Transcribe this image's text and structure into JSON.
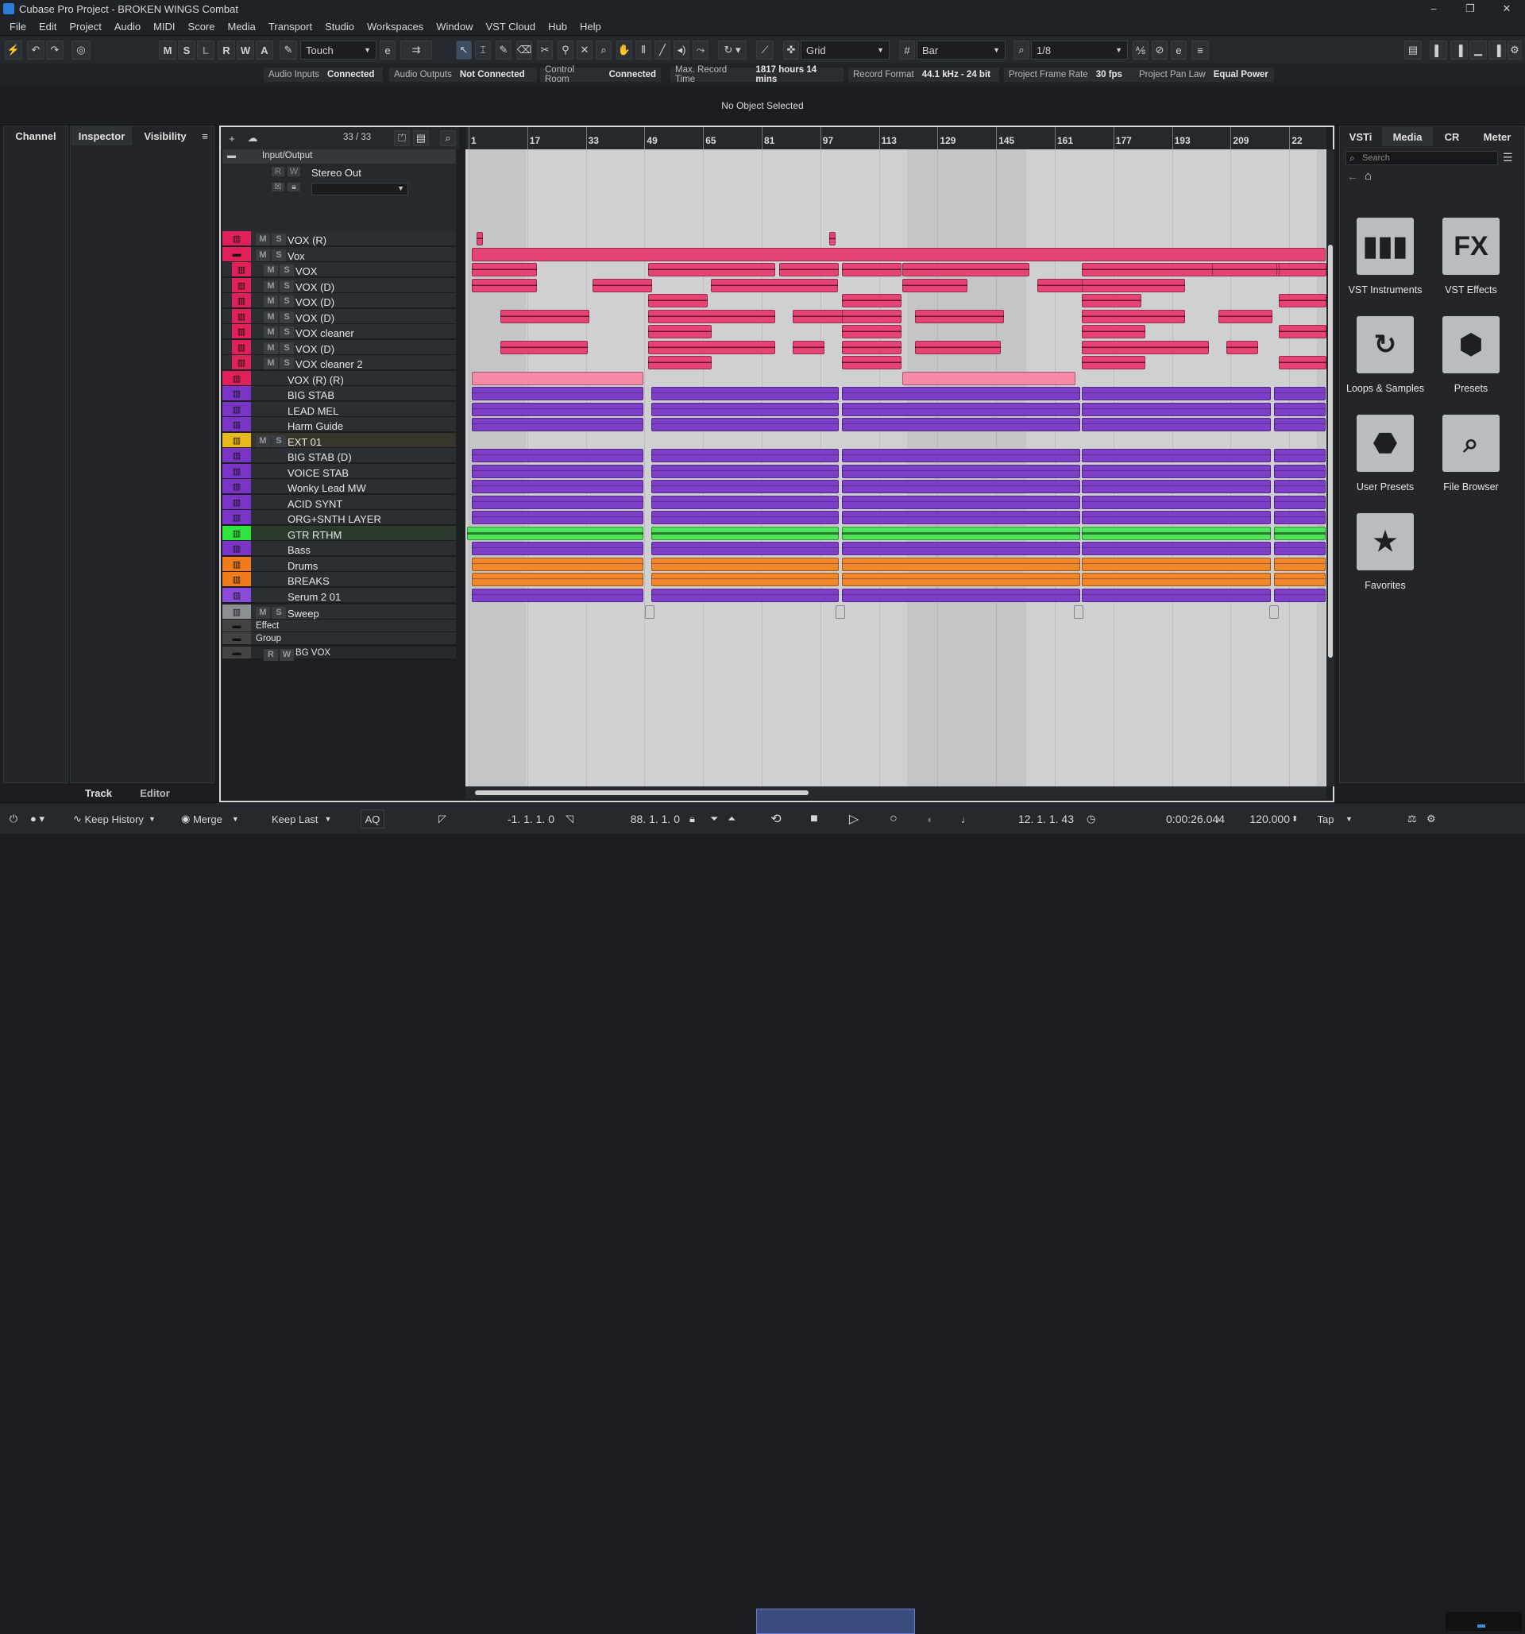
{
  "window": {
    "title": "Cubase Pro Project - BROKEN WINGS Combat"
  },
  "menu": [
    "File",
    "Edit",
    "Project",
    "Audio",
    "MIDI",
    "Score",
    "Media",
    "Transport",
    "Studio",
    "Workspaces",
    "Window",
    "VST Cloud",
    "Hub",
    "Help"
  ],
  "toolbar": {
    "m": "M",
    "s": "S",
    "l": "L",
    "r": "R",
    "w": "W",
    "a": "A",
    "automation_mode": "Touch",
    "snap_type": "Grid",
    "grid_type": "Bar",
    "quantize": "1/8"
  },
  "status": [
    {
      "label": "Audio Inputs",
      "value": "Connected"
    },
    {
      "label": "Audio Outputs",
      "value": "Not Connected"
    },
    {
      "label": "Control Room",
      "value": "Connected"
    },
    {
      "label": "Max. Record Time",
      "value": "1817 hours 14 mins"
    },
    {
      "label": "Record Format",
      "value": "44.1 kHz - 24 bit"
    },
    {
      "label": "Project Frame Rate",
      "value": "30 fps"
    },
    {
      "label": "Project Pan Law",
      "value": "Equal Power"
    }
  ],
  "info_line": "No Object Selected",
  "left_zone": {
    "tab_channel": "Channel",
    "tab_inspector": "Inspector",
    "tab_visibility": "Visibility",
    "tab_track": "Track",
    "tab_editor": "Editor"
  },
  "track_list": {
    "count": "33 / 33",
    "io_folder": "Input/Output",
    "stereo_out": "Stereo Out",
    "r": "R",
    "w": "W",
    "tracks": [
      {
        "name": "VOX (R)",
        "color": "#e0205a",
        "ms": true
      },
      {
        "name": "Vox",
        "color": "#e0205a",
        "ms": true
      },
      {
        "name": "VOX",
        "color": "#e0205a",
        "ms": true
      },
      {
        "name": "VOX (D)",
        "color": "#e0205a",
        "ms": true
      },
      {
        "name": "VOX (D)",
        "color": "#e0205a",
        "ms": true
      },
      {
        "name": "VOX (D)",
        "color": "#e0205a",
        "ms": true
      },
      {
        "name": "VOX cleaner",
        "color": "#e0205a",
        "ms": true
      },
      {
        "name": "VOX (D)",
        "color": "#e0205a",
        "ms": true
      },
      {
        "name": "VOX cleaner 2",
        "color": "#e0205a",
        "ms": true
      },
      {
        "name": "VOX (R) (R)",
        "color": "#e0205a",
        "ms": false
      },
      {
        "name": "BIG STAB",
        "color": "#7b35c6",
        "ms": false
      },
      {
        "name": "LEAD MEL",
        "color": "#7b35c6",
        "ms": false
      },
      {
        "name": "Harm Guide",
        "color": "#7b35c6",
        "ms": false
      },
      {
        "name": "EXT 01",
        "color": "#e8b91c",
        "ms": true
      },
      {
        "name": "BIG STAB (D)",
        "color": "#7b35c6",
        "ms": false
      },
      {
        "name": "VOICE STAB",
        "color": "#7b35c6",
        "ms": false
      },
      {
        "name": "Wonky Lead MW",
        "color": "#7b35c6",
        "ms": false
      },
      {
        "name": "ACID SYNT",
        "color": "#7b35c6",
        "ms": false
      },
      {
        "name": "ORG+SNTH LAYER",
        "color": "#7b35c6",
        "ms": false
      },
      {
        "name": "GTR RTHM",
        "color": "#2fe43c",
        "ms": false
      },
      {
        "name": "Bass",
        "color": "#7b35c6",
        "ms": false
      },
      {
        "name": "Drums",
        "color": "#ef7b1a",
        "ms": false
      },
      {
        "name": "BREAKS",
        "color": "#ef7b1a",
        "ms": false
      },
      {
        "name": "Serum 2 01",
        "color": "#8a4bd8",
        "ms": false
      },
      {
        "name": "Sweep",
        "color": "#8d8f93",
        "ms": true
      },
      {
        "name": "Effect",
        "color": "#444",
        "ms": false
      },
      {
        "name": "Group",
        "color": "#444",
        "ms": false
      },
      {
        "name": "BG VOX",
        "color": "#444",
        "ms": false
      }
    ]
  },
  "ruler": [
    "1",
    "17",
    "33",
    "49",
    "65",
    "81",
    "97",
    "113",
    "129",
    "145",
    "161",
    "177",
    "193",
    "209",
    "22"
  ],
  "right_zone": {
    "tab_vsti": "VSTi",
    "tab_media": "Media",
    "tab_cr": "CR",
    "tab_meter": "Meter",
    "search_placeholder": "Search",
    "tiles": [
      {
        "label": "VST Instruments",
        "icon": "piano-keys-icon"
      },
      {
        "label": "VST Effects",
        "icon": "fx-icon"
      },
      {
        "label": "Loops & Samples",
        "icon": "loop-icon"
      },
      {
        "label": "Presets",
        "icon": "presets-icon"
      },
      {
        "label": "User Presets",
        "icon": "user-presets-icon"
      },
      {
        "label": "File Browser",
        "icon": "file-browser-icon"
      },
      {
        "label": "Favorites",
        "icon": "star-icon"
      }
    ]
  },
  "transport": {
    "history": "Keep History",
    "merge": "Merge",
    "keep_last": "Keep Last",
    "aq": "AQ",
    "left_locator": "-1. 1. 1.   0",
    "right_locator": "88. 1. 1.   0",
    "position_bars": "12. 1. 1.  43",
    "position_time": "0:00:26.044",
    "tempo": "120.000",
    "tap": "Tap"
  }
}
